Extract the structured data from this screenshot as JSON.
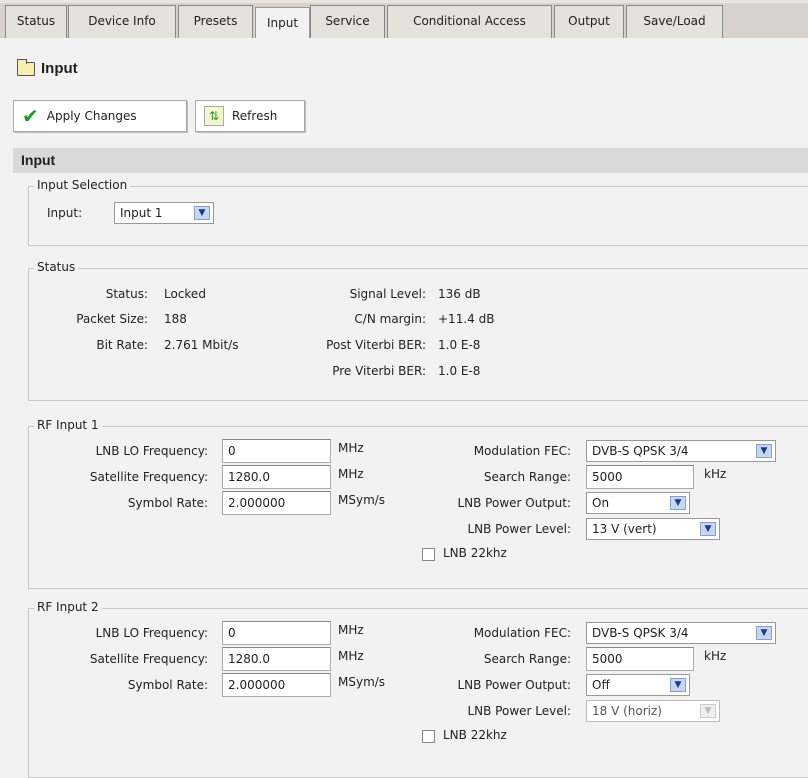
{
  "tabs": [
    {
      "label": "Status"
    },
    {
      "label": "Device Info"
    },
    {
      "label": "Presets"
    },
    {
      "label": "Input",
      "active": true
    },
    {
      "label": "Service"
    },
    {
      "label": "Conditional Access"
    },
    {
      "label": "Output"
    },
    {
      "label": "Save/Load"
    }
  ],
  "page_title": "Input",
  "toolbar": {
    "apply_label": "Apply Changes",
    "refresh_label": "Refresh"
  },
  "section_title": "Input",
  "input_selection": {
    "legend": "Input Selection",
    "label": "Input:",
    "value": "Input 1"
  },
  "status": {
    "legend": "Status",
    "left": [
      {
        "label": "Status:",
        "value": "Locked"
      },
      {
        "label": "Packet Size:",
        "value": "188"
      },
      {
        "label": "Bit Rate:",
        "value": "2.761 Mbit/s"
      }
    ],
    "right": [
      {
        "label": "Signal Level:",
        "value": "136 dB"
      },
      {
        "label": "C/N margin:",
        "value": "+11.4 dB"
      },
      {
        "label": "Post Viterbi BER:",
        "value": "1.0 E-8"
      },
      {
        "label": "Pre Viterbi BER:",
        "value": "1.0 E-8"
      }
    ]
  },
  "rf_inputs": [
    {
      "legend": "RF Input 1",
      "lnb_lo_label": "LNB LO Frequency:",
      "lnb_lo": "0",
      "lnb_lo_unit": "MHz",
      "sat_label": "Satellite Frequency:",
      "sat": "1280.0",
      "sat_unit": "MHz",
      "sym_label": "Symbol Rate:",
      "sym": "2.000000",
      "sym_unit": "MSym/s",
      "fec_label": "Modulation FEC:",
      "fec": "DVB-S QPSK 3/4",
      "range_label": "Search Range:",
      "range": "5000",
      "range_unit": "kHz",
      "power_out_label": "LNB Power Output:",
      "power_out": "On",
      "power_level_label": "LNB Power Level:",
      "power_level": "13 V (vert)",
      "power_level_disabled": false,
      "khz_label": "LNB 22khz",
      "khz_checked": false
    },
    {
      "legend": "RF Input 2",
      "lnb_lo_label": "LNB LO Frequency:",
      "lnb_lo": "0",
      "lnb_lo_unit": "MHz",
      "sat_label": "Satellite Frequency:",
      "sat": "1280.0",
      "sat_unit": "MHz",
      "sym_label": "Symbol Rate:",
      "sym": "2.000000",
      "sym_unit": "MSym/s",
      "fec_label": "Modulation FEC:",
      "fec": "DVB-S QPSK 3/4",
      "range_label": "Search Range:",
      "range": "5000",
      "range_unit": "kHz",
      "power_out_label": "LNB Power Output:",
      "power_out": "Off",
      "power_level_label": "LNB Power Level:",
      "power_level": "18 V (horiz)",
      "power_level_disabled": true,
      "khz_label": "LNB 22khz",
      "khz_checked": false
    }
  ]
}
